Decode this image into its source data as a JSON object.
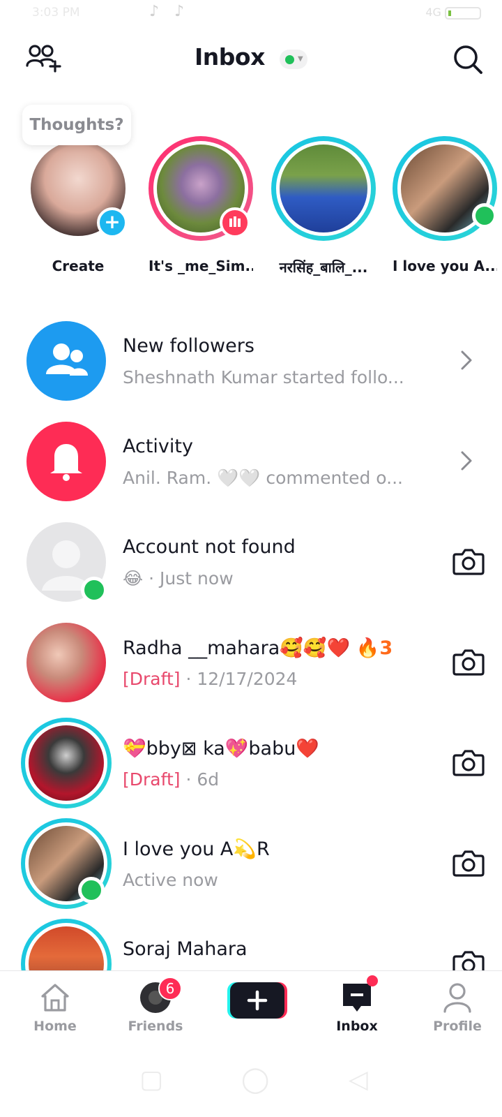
{
  "status_bar": {
    "time": "3:03 PM",
    "right": "4G"
  },
  "header": {
    "title": "Inbox"
  },
  "stories": {
    "thought_prompt": "Thoughts?",
    "items": [
      {
        "name": "Create"
      },
      {
        "name": "It's _me_Sim..."
      },
      {
        "name": "नरसिंह_बालि_..."
      },
      {
        "name": "I love you A..."
      }
    ]
  },
  "messages": [
    {
      "title": "New followers",
      "subtitle": "Sheshnath Kumar started follo..."
    },
    {
      "title": "Activity",
      "subtitle": "Anil. Ram. 🤍🤍 commented o..."
    },
    {
      "title": "Account not found",
      "subtitle_emoji": "😂",
      "subtitle": " · Just now"
    },
    {
      "title": "Radha __mahara🥰🥰❤️",
      "streak": "🔥3",
      "draft": "[Draft]",
      "subtitle": " · 12/17/2024"
    },
    {
      "title": "💝bby⊠ ka💖babu❤️",
      "draft": "[Draft]",
      "subtitle": "  · 6d"
    },
    {
      "title": "I love you A💫R",
      "subtitle": "Active now"
    },
    {
      "title": "Soraj Mahara",
      "subtitle": ""
    }
  ],
  "bottom_nav": {
    "home": "Home",
    "friends": "Friends",
    "friends_badge": "6",
    "inbox": "Inbox",
    "profile": "Profile"
  },
  "colors": {
    "accent": "#fe2c55",
    "online": "#20c05a",
    "story_ring_cyan": "#19c5e3",
    "story_ring_pink": "#ff2d6f"
  }
}
